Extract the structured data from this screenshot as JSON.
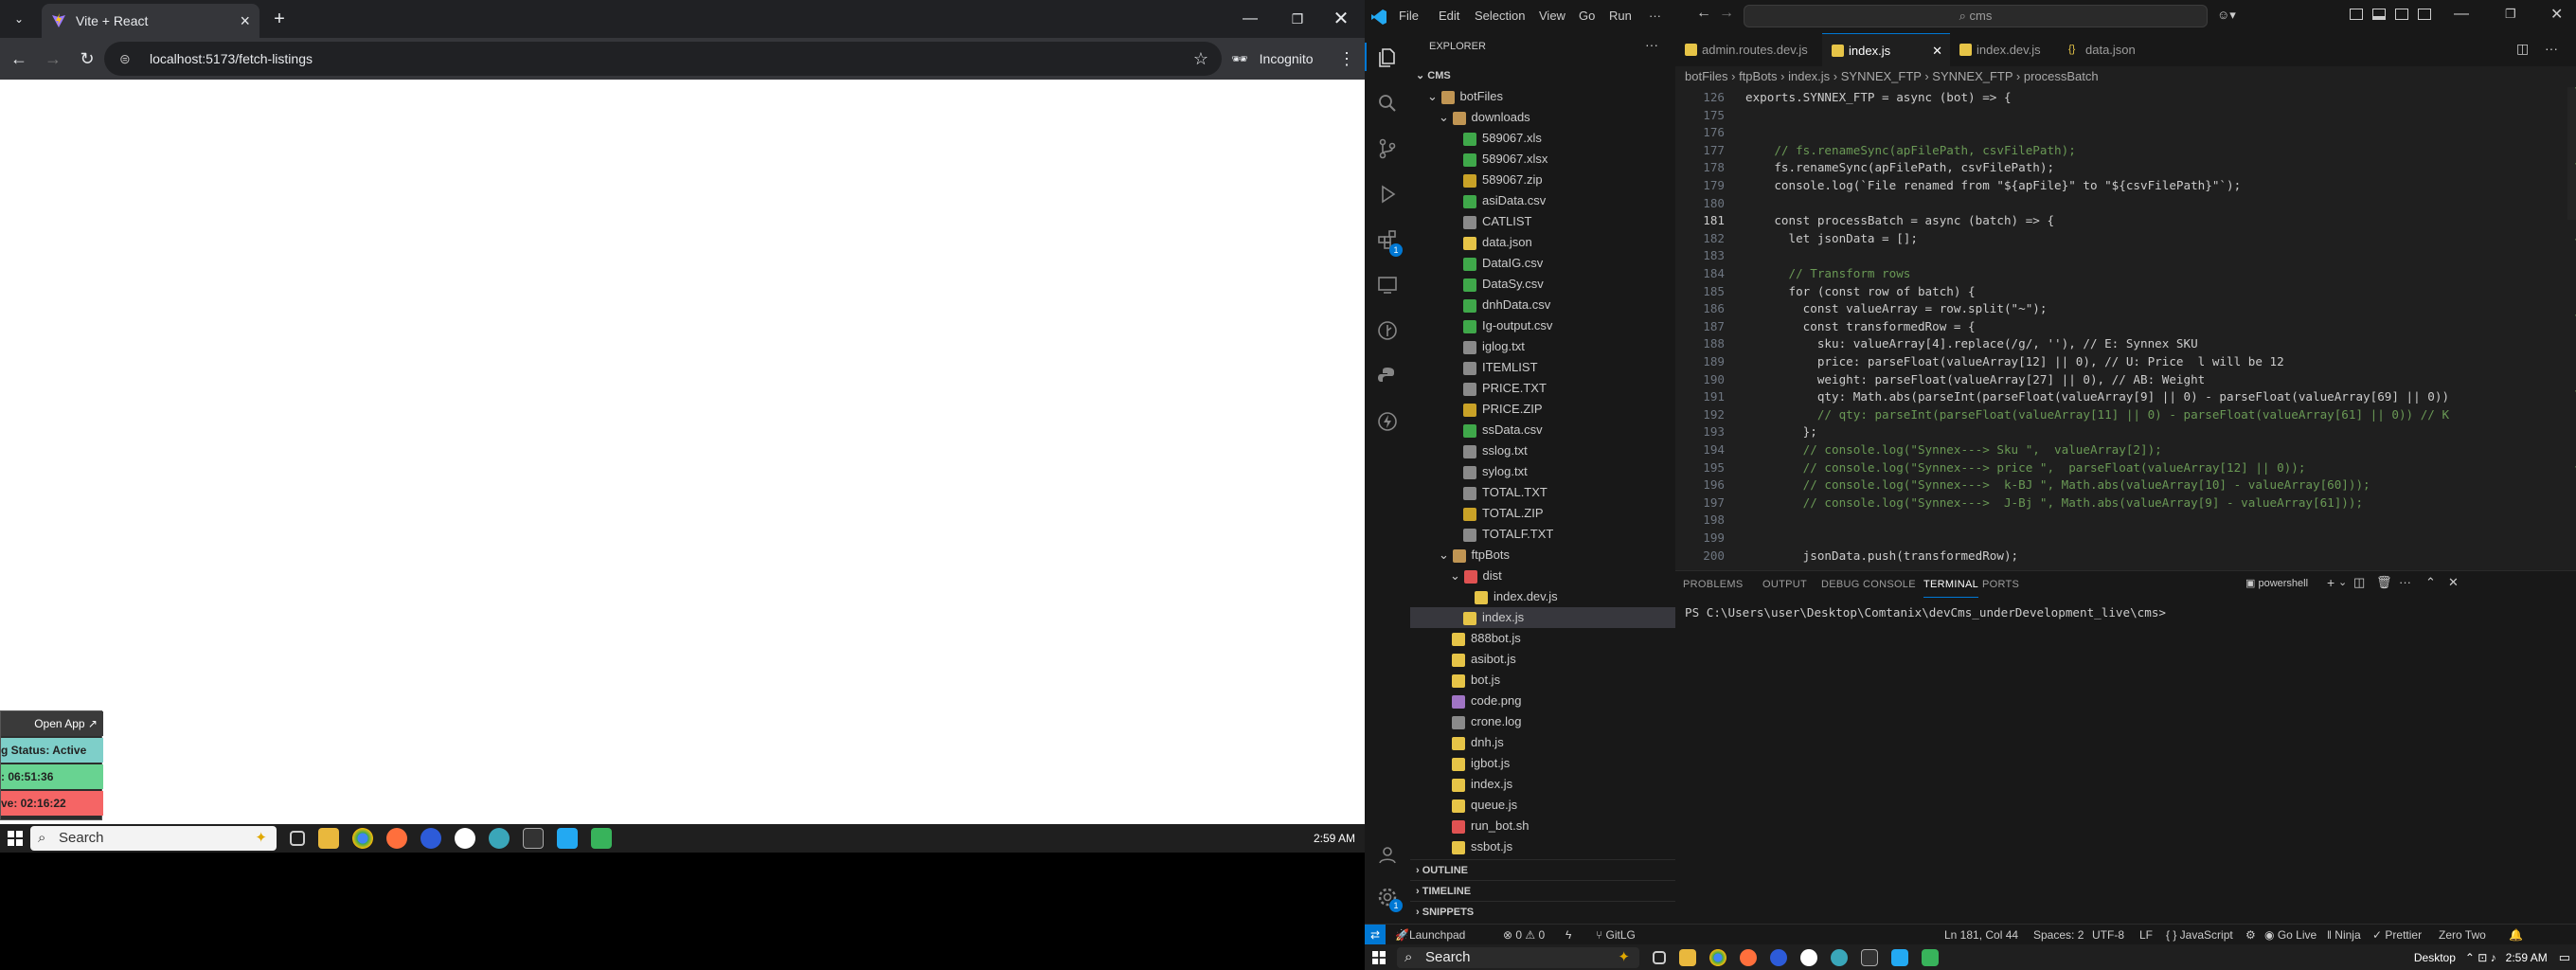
{
  "browser": {
    "tab_title": "Vite + React",
    "url": "localhost:5173/fetch-listings",
    "incognito_label": "Incognito",
    "new_tab": "+",
    "close": "×"
  },
  "widget": {
    "open_app": "Open App ↗",
    "status": "g Status: Active",
    "time1": ": 06:51:36",
    "time2": "ve: 02:16:22"
  },
  "taskbar_left": {
    "search": "Search",
    "time": "2:59 AM"
  },
  "taskbar_right": {
    "search": "Search",
    "desktop": "Desktop",
    "time": "2:59 AM"
  },
  "vscode": {
    "menu": [
      "File",
      "Edit",
      "Selection",
      "View",
      "Go",
      "Run",
      "···"
    ],
    "command_center": "cms",
    "explorer_title": "EXPLORER",
    "explorer_more": "···",
    "root": "CMS",
    "tree": [
      {
        "label": "botFiles",
        "indent": 1,
        "type": "folder-open"
      },
      {
        "label": "downloads",
        "indent": 2,
        "type": "folder-open"
      },
      {
        "label": "589067.xls",
        "indent": 3,
        "type": "xls"
      },
      {
        "label": "589067.xlsx",
        "indent": 3,
        "type": "xls"
      },
      {
        "label": "589067.zip",
        "indent": 3,
        "type": "zip"
      },
      {
        "label": "asiData.csv",
        "indent": 3,
        "type": "csv"
      },
      {
        "label": "CATLIST",
        "indent": 3,
        "type": "txt"
      },
      {
        "label": "data.json",
        "indent": 3,
        "type": "json"
      },
      {
        "label": "DataIG.csv",
        "indent": 3,
        "type": "csv"
      },
      {
        "label": "DataSy.csv",
        "indent": 3,
        "type": "csv"
      },
      {
        "label": "dnhData.csv",
        "indent": 3,
        "type": "csv"
      },
      {
        "label": "Ig-output.csv",
        "indent": 3,
        "type": "csv"
      },
      {
        "label": "iglog.txt",
        "indent": 3,
        "type": "txt"
      },
      {
        "label": "ITEMLIST",
        "indent": 3,
        "type": "txt"
      },
      {
        "label": "PRICE.TXT",
        "indent": 3,
        "type": "txt"
      },
      {
        "label": "PRICE.ZIP",
        "indent": 3,
        "type": "zip"
      },
      {
        "label": "ssData.csv",
        "indent": 3,
        "type": "csv"
      },
      {
        "label": "sslog.txt",
        "indent": 3,
        "type": "txt"
      },
      {
        "label": "sylog.txt",
        "indent": 3,
        "type": "txt"
      },
      {
        "label": "TOTAL.TXT",
        "indent": 3,
        "type": "txt"
      },
      {
        "label": "TOTAL.ZIP",
        "indent": 3,
        "type": "zip"
      },
      {
        "label": "TOTALF.TXT",
        "indent": 3,
        "type": "txt"
      },
      {
        "label": "ftpBots",
        "indent": 2,
        "type": "folder-open"
      },
      {
        "label": "dist",
        "indent": 3,
        "type": "folder-red"
      },
      {
        "label": "index.dev.js",
        "indent": 4,
        "type": "js"
      },
      {
        "label": "index.js",
        "indent": 3,
        "type": "js",
        "selected": true
      },
      {
        "label": "888bot.js",
        "indent": 2,
        "type": "js"
      },
      {
        "label": "asibot.js",
        "indent": 2,
        "type": "js"
      },
      {
        "label": "bot.js",
        "indent": 2,
        "type": "js"
      },
      {
        "label": "code.png",
        "indent": 2,
        "type": "img"
      },
      {
        "label": "crone.log",
        "indent": 2,
        "type": "log"
      },
      {
        "label": "dnh.js",
        "indent": 2,
        "type": "js"
      },
      {
        "label": "igbot.js",
        "indent": 2,
        "type": "js"
      },
      {
        "label": "index.js",
        "indent": 2,
        "type": "js"
      },
      {
        "label": "queue.js",
        "indent": 2,
        "type": "js"
      },
      {
        "label": "run_bot.sh",
        "indent": 2,
        "type": "sh"
      },
      {
        "label": "ssbot.js",
        "indent": 2,
        "type": "js"
      }
    ],
    "outline": "OUTLINE",
    "timeline": "TIMELINE",
    "snippets": "SNIPPETS",
    "tabs": [
      {
        "label": "admin.routes.dev.js",
        "active": false
      },
      {
        "label": "index.js",
        "active": true
      },
      {
        "label": "index.dev.js",
        "active": false
      },
      {
        "label": "data.json",
        "active": false
      }
    ],
    "breadcrumb": "botFiles  ›  ftpBots  ›  index.js  ›  SYNNEX_FTP  ›  SYNNEX_FTP  ›  processBatch",
    "code": [
      {
        "n": "126",
        "t": "exports.SYNNEX_FTP = async (bot) => {"
      },
      {
        "n": "175",
        "t": ""
      },
      {
        "n": "176",
        "t": ""
      },
      {
        "n": "177",
        "t": "    // fs.renameSync(apFilePath, csvFilePath);"
      },
      {
        "n": "178",
        "t": "    fs.renameSync(apFilePath, csvFilePath);"
      },
      {
        "n": "179",
        "t": "    console.log(`File renamed from \"${apFile}\" to \"${csvFilePath}\"`);"
      },
      {
        "n": "180",
        "t": ""
      },
      {
        "n": "181",
        "t": "    const processBatch = async (batch) => {"
      },
      {
        "n": "182",
        "t": "      let jsonData = [];"
      },
      {
        "n": "183",
        "t": ""
      },
      {
        "n": "184",
        "t": "      // Transform rows"
      },
      {
        "n": "185",
        "t": "      for (const row of batch) {"
      },
      {
        "n": "186",
        "t": "        const valueArray = row.split(\"~\");"
      },
      {
        "n": "187",
        "t": "        const transformedRow = {"
      },
      {
        "n": "188",
        "t": "          sku: valueArray[4].replace(/g/, ''), // E: Synnex SKU"
      },
      {
        "n": "189",
        "t": "          price: parseFloat(valueArray[12] || 0), // U: Price  l will be 12"
      },
      {
        "n": "190",
        "t": "          weight: parseFloat(valueArray[27] || 0), // AB: Weight"
      },
      {
        "n": "191",
        "t": "          qty: Math.abs(parseInt(parseFloat(valueArray[9] || 0) - parseFloat(valueArray[69] || 0))"
      },
      {
        "n": "192",
        "t": "          // qty: parseInt(parseFloat(valueArray[11] || 0) - parseFloat(valueArray[61] || 0)) // K"
      },
      {
        "n": "193",
        "t": "        };"
      },
      {
        "n": "194",
        "t": "        // console.log(\"Synnex---> Sku \",  valueArray[2]);"
      },
      {
        "n": "195",
        "t": "        // console.log(\"Synnex---> price \",  parseFloat(valueArray[12] || 0));"
      },
      {
        "n": "196",
        "t": "        // console.log(\"Synnex--->  k-BJ \", Math.abs(valueArray[10] - valueArray[60]));"
      },
      {
        "n": "197",
        "t": "        // console.log(\"Synnex--->  J-Bj \", Math.abs(valueArray[9] - valueArray[61]));"
      },
      {
        "n": "198",
        "t": ""
      },
      {
        "n": "199",
        "t": ""
      },
      {
        "n": "200",
        "t": "        jsonData.push(transformedRow);"
      }
    ],
    "panel_tabs": [
      "PROBLEMS",
      "OUTPUT",
      "DEBUG CONSOLE",
      "TERMINAL",
      "PORTS"
    ],
    "panel_active": "TERMINAL",
    "terminal_shell": "powershell",
    "terminal_line": "PS C:\\Users\\user\\Desktop\\Comtanix\\devCms_underDevelopment_live\\cms>",
    "status": {
      "remote": "",
      "launchpad": "Launchpad",
      "problems": "⊗ 0 ⚠ 0",
      "gitlg": "GitLG",
      "position": "Ln 181, Col 44",
      "spaces": "Spaces: 2",
      "encoding": "UTF-8",
      "eol": "LF",
      "language": "{ } JavaScript",
      "golive": "Go Live",
      "ninja": "Ninja",
      "prettier": "Prettier",
      "theme": "Zero Two"
    }
  }
}
